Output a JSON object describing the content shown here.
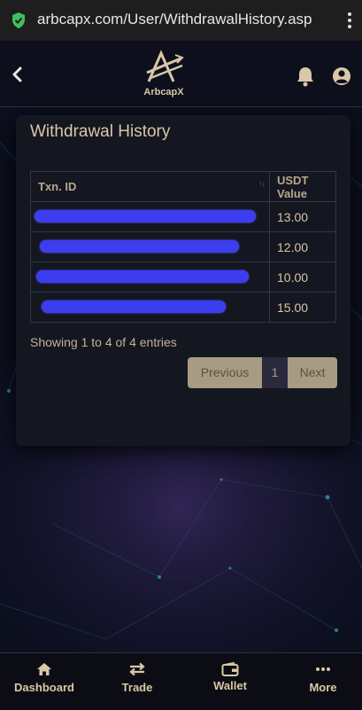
{
  "browser": {
    "url": "arbcapx.com/User/WithdrawalHistory.asp"
  },
  "header": {
    "brand": "ArbcapX",
    "icons": [
      "back-arrow-icon",
      "bell-icon",
      "user-icon"
    ]
  },
  "card": {
    "title": "Withdrawal History",
    "table": {
      "headers": [
        "Txn. ID",
        "USDT Value"
      ],
      "rows": [
        {
          "txn": "",
          "value": "13.00"
        },
        {
          "txn": "",
          "value": "12.00"
        },
        {
          "txn": "",
          "value": "10.00"
        },
        {
          "txn": "",
          "value": "15.00"
        }
      ]
    },
    "info": "Showing 1 to 4 of 4 entries",
    "pagination": {
      "previous": "Previous",
      "current": "1",
      "next": "Next"
    }
  },
  "bottom_nav": [
    {
      "label": "Dashboard",
      "icon": "home-icon"
    },
    {
      "label": "Trade",
      "icon": "swap-icon"
    },
    {
      "label": "Wallet",
      "icon": "wallet-icon"
    },
    {
      "label": "More",
      "icon": "more-dots-icon"
    }
  ],
  "colors": {
    "accent": "#d9c7a6",
    "background": "#0b0f1e",
    "card": "#141620",
    "redaction": "#3d3df0"
  }
}
